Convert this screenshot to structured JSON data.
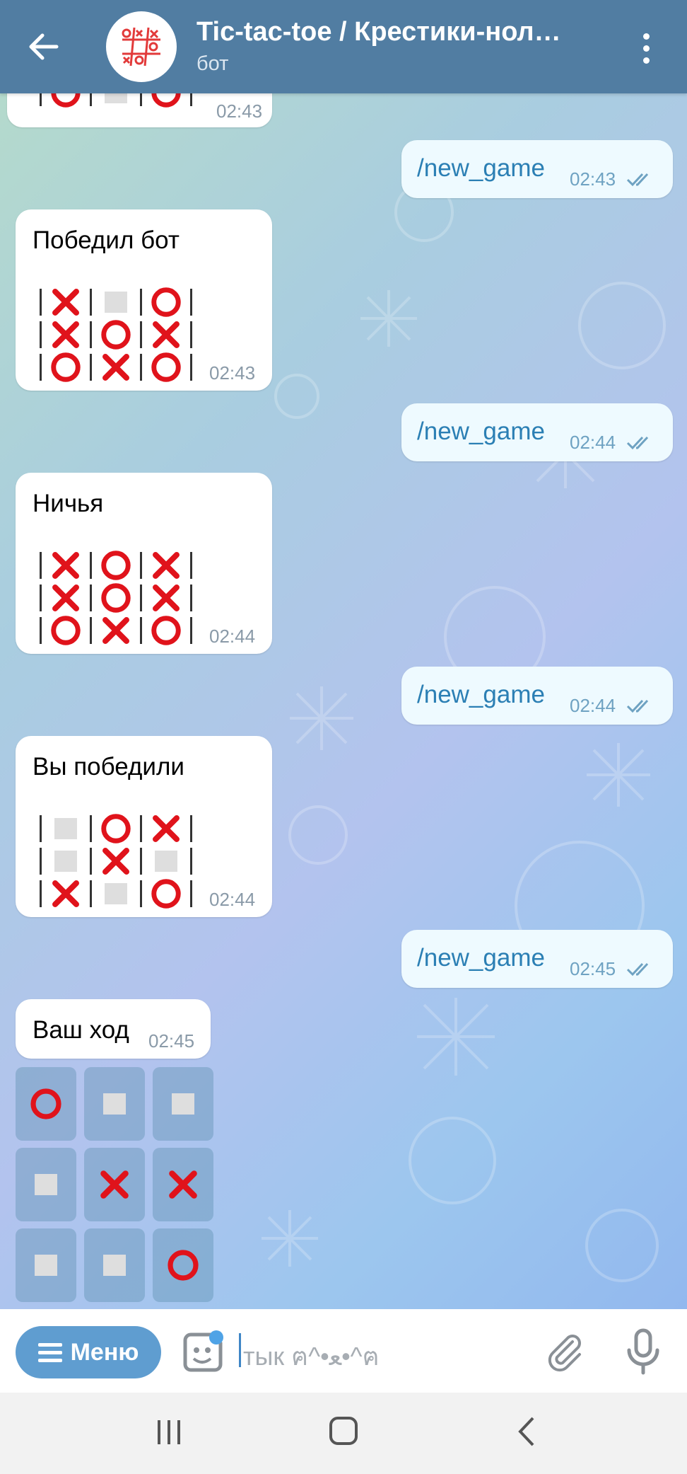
{
  "header": {
    "title": "Tic-tac-toe / Крестики-нол…",
    "subtitle": "бот",
    "avatar_text": "⚪❌#"
  },
  "messages": [
    {
      "id": "m0",
      "from": "bot",
      "time": "02:43",
      "board": [
        [
          "O",
          "_",
          "O"
        ]
      ]
    },
    {
      "id": "m1",
      "from": "user",
      "text": "/new_game",
      "time": "02:43"
    },
    {
      "id": "m2",
      "from": "bot",
      "text": "Победил бот",
      "time": "02:43",
      "board": [
        [
          "X",
          "_",
          "O"
        ],
        [
          "X",
          "O",
          "X"
        ],
        [
          "O",
          "X",
          "O"
        ]
      ]
    },
    {
      "id": "m3",
      "from": "user",
      "text": "/new_game",
      "time": "02:44"
    },
    {
      "id": "m4",
      "from": "bot",
      "text": "Ничья",
      "time": "02:44",
      "board": [
        [
          "X",
          "O",
          "X"
        ],
        [
          "X",
          "O",
          "X"
        ],
        [
          "O",
          "X",
          "O"
        ]
      ]
    },
    {
      "id": "m5",
      "from": "user",
      "text": "/new_game",
      "time": "02:44"
    },
    {
      "id": "m6",
      "from": "bot",
      "text": "Вы победили",
      "time": "02:44",
      "board": [
        [
          "_",
          "O",
          "X"
        ],
        [
          "_",
          "X",
          "_"
        ],
        [
          "X",
          "_",
          "O"
        ]
      ]
    },
    {
      "id": "m7",
      "from": "user",
      "text": "/new_game",
      "time": "02:45"
    },
    {
      "id": "m8",
      "from": "bot",
      "text": "Ваш ход",
      "time": "02:45"
    }
  ],
  "inline_keyboard": [
    [
      "O",
      "_",
      "_"
    ],
    [
      "_",
      "X",
      "X"
    ],
    [
      "_",
      "_",
      "O"
    ]
  ],
  "input": {
    "menu_label": "Меню",
    "placeholder": "тык ฅ^•ﻌ•^ฅ"
  },
  "colors": {
    "header": "#517da2",
    "symbol_red": "#e0131b",
    "command_blue": "#2b7fb4",
    "menu_button": "#5f9dd0"
  },
  "icons": {
    "back": "arrow-left-icon",
    "more": "more-vertical-icon",
    "menu": "hamburger-icon",
    "sticker": "sticker-icon",
    "attach": "paperclip-icon",
    "mic": "microphone-icon",
    "read": "double-check-icon"
  }
}
